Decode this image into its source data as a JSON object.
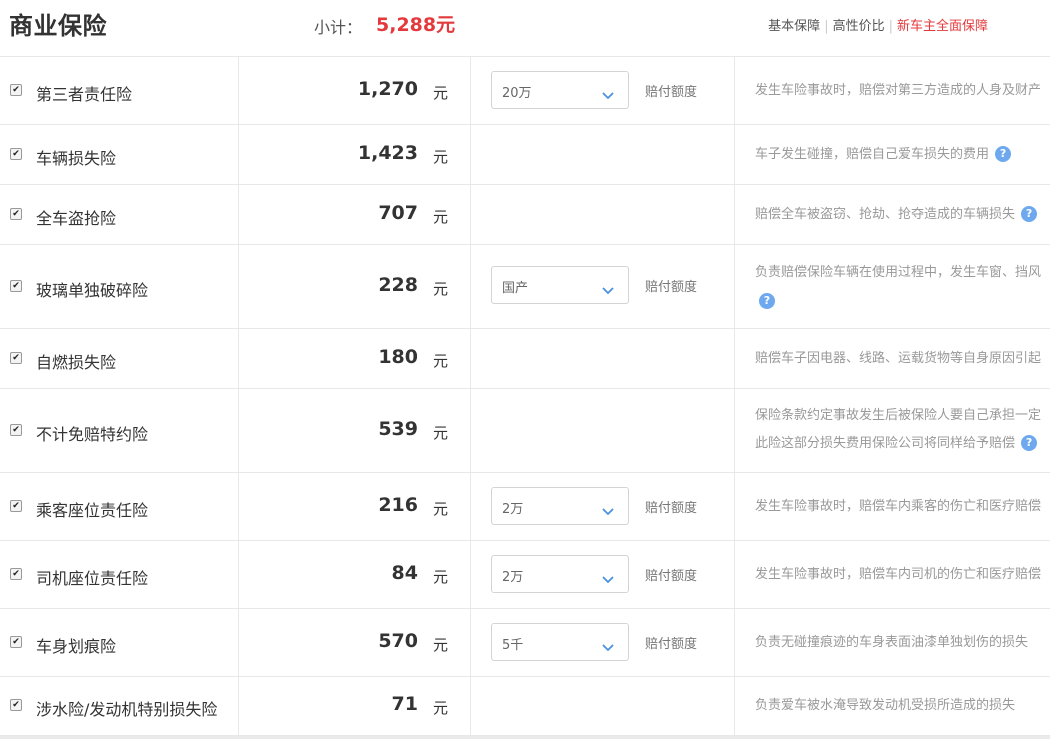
{
  "header": {
    "title": "商业保险",
    "subtotal_label": "小计：",
    "subtotal_value": "5,288元",
    "filters": [
      "基本保障",
      "高性价比",
      "新车主全面保障"
    ],
    "active_filter": "新车主全面保障"
  },
  "currency_unit": "元",
  "amount_label": "赔付额度",
  "rows": [
    {
      "name": "第三者责任险",
      "price": "1,270",
      "select": "20万",
      "desc1": "发生车险事故时，赔偿对第三方造成的人身及财产",
      "desc2": ""
    },
    {
      "name": "车辆损失险",
      "price": "1,423",
      "select": null,
      "desc1": "车子发生碰撞，赔偿自己爱车损失的费用",
      "desc2": ""
    },
    {
      "name": "全车盗抢险",
      "price": "707",
      "select": null,
      "desc1": "赔偿全车被盗窃、抢劫、抢夺造成的车辆损失",
      "desc2": ""
    },
    {
      "name": "玻璃单独破碎险",
      "price": "228",
      "select": "国产",
      "desc1": "负责赔偿保险车辆在使用过程中，发生车窗、挡风",
      "desc2": ""
    },
    {
      "name": "自燃损失险",
      "price": "180",
      "select": null,
      "desc1": "赔偿车子因电器、线路、运载货物等自身原因引起",
      "desc2": ""
    },
    {
      "name": "不计免赔特约险",
      "price": "539",
      "select": null,
      "desc1": "保险条款约定事故发生后被保险人要自己承担一定",
      "desc2": "此险这部分损失费用保险公司将同样给予赔偿"
    },
    {
      "name": "乘客座位责任险",
      "price": "216",
      "select": "2万",
      "desc1": "发生车险事故时，赔偿车内乘客的伤亡和医疗赔偿",
      "desc2": ""
    },
    {
      "name": "司机座位责任险",
      "price": "84",
      "select": "2万",
      "desc1": "发生车险事故时，赔偿车内司机的伤亡和医疗赔偿",
      "desc2": ""
    },
    {
      "name": "车身划痕险",
      "price": "570",
      "select": "5千",
      "desc1": "负责无碰撞痕迹的车身表面油漆单独划伤的损失",
      "desc2": ""
    },
    {
      "name": "涉水险/发动机特别损失险",
      "price": "71",
      "select": null,
      "desc1": "负责爱车被水淹导致发动机受损所造成的损失",
      "desc2": ""
    }
  ],
  "colors": {
    "accent": "#e4393c",
    "help_icon": "#6ea9f0"
  },
  "icons": {
    "checkbox": "checkbox-checked-icon",
    "dropdown": "chevron-down-icon",
    "help": "help-icon"
  }
}
